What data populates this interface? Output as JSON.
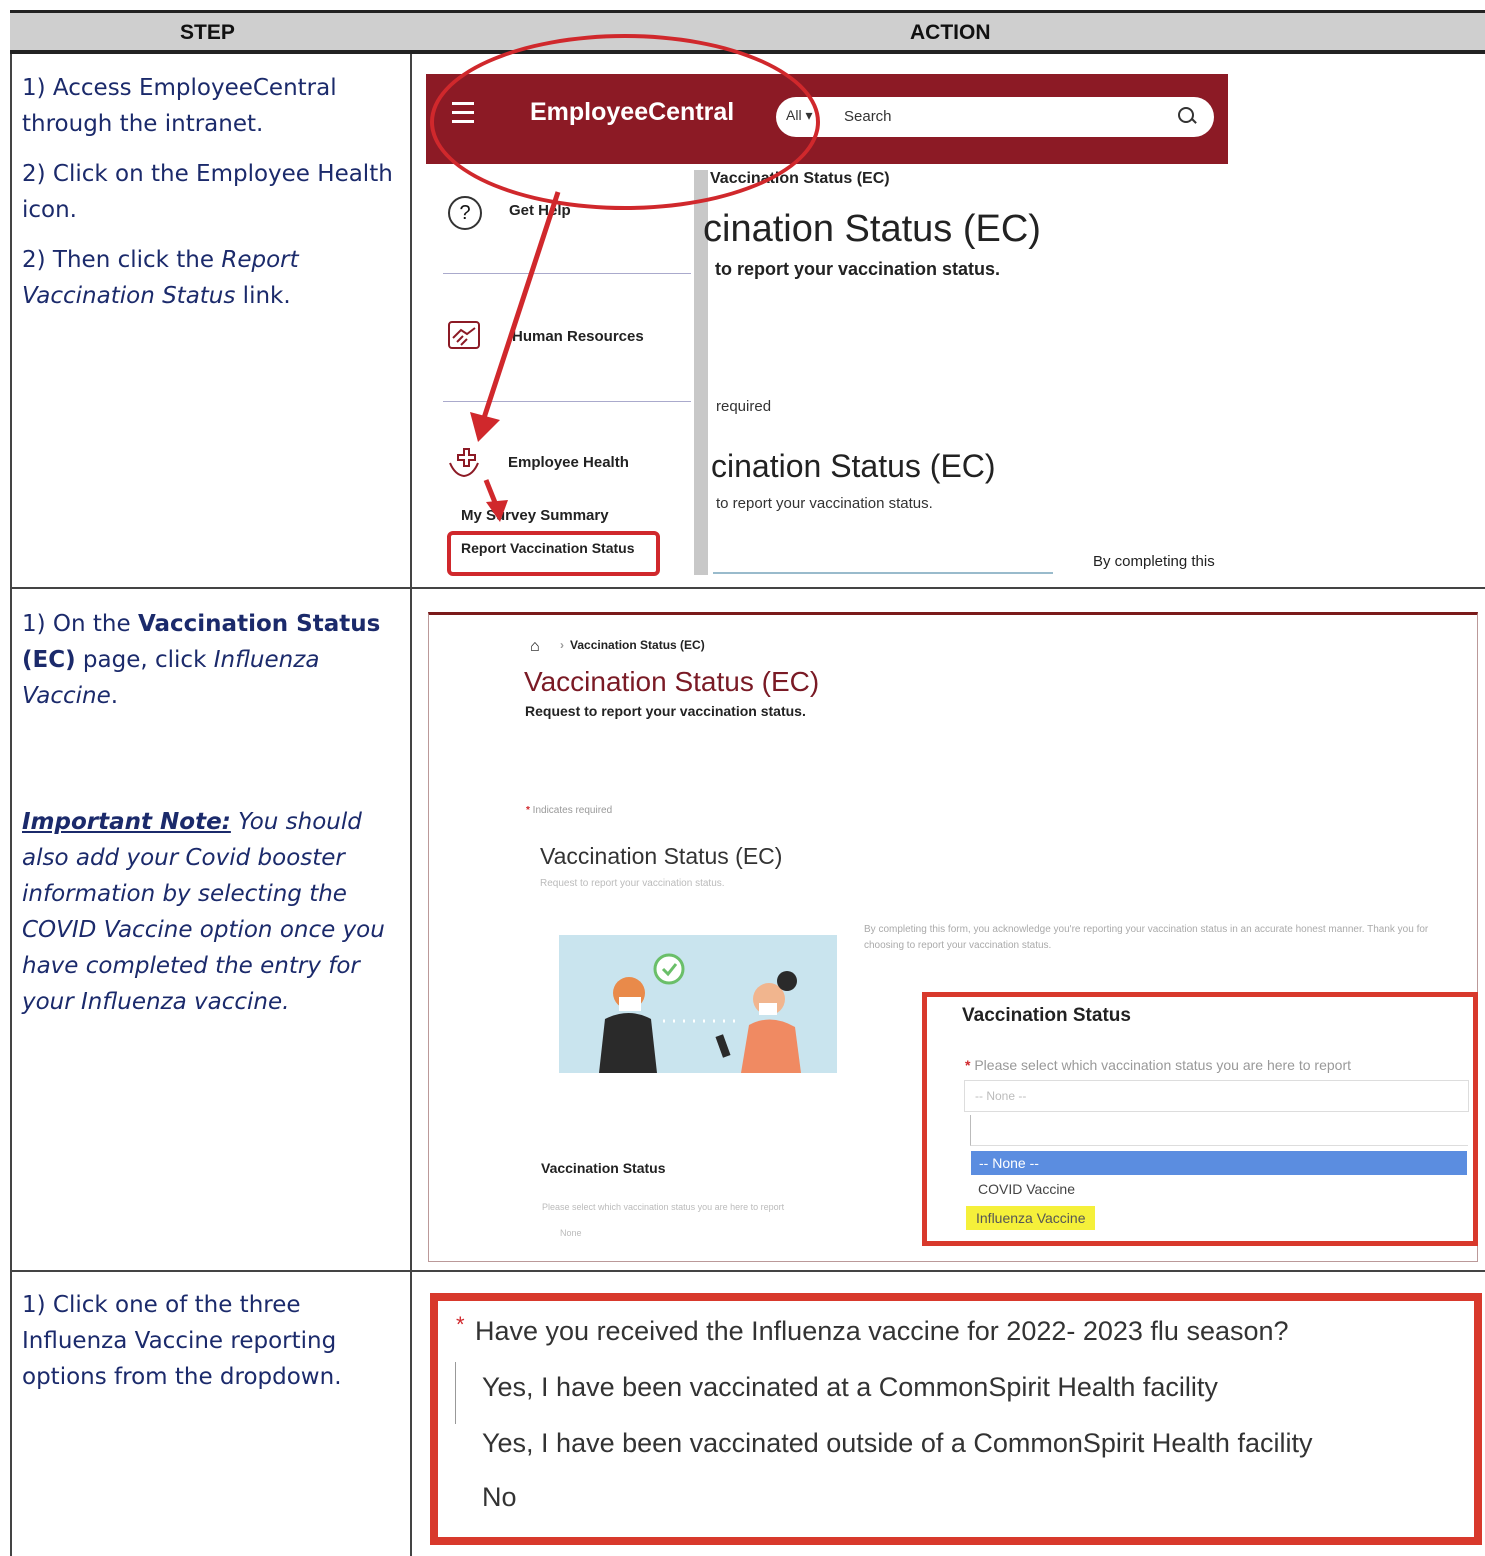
{
  "header": {
    "step": "STEP",
    "action": "ACTION"
  },
  "row1": {
    "steps": [
      "1) Access EmployeeCentral through the intranet.",
      "2) Click on the Employee Health icon."
    ],
    "step3_prefix": "2) Then click the ",
    "step3_link": "Report Vaccination Status",
    "step3_suffix": " link.",
    "screen": {
      "app_title": "EmployeeCentral",
      "search_scope": "All",
      "search_placeholder": "Search",
      "get_help": "Get Help",
      "human_resources": "Human Resources",
      "employee_health": "Employee Health",
      "my_survey_summary": "My Survey Summary",
      "report_vaccination_status": "Report Vaccination Status",
      "crumb": "Vaccination Status (EC)",
      "big_title": "cination Status (EC)",
      "subtitle": "to report your vaccination status.",
      "required": "required",
      "big_title_2": "cination Status (EC)",
      "subtitle_2": "to report your vaccination status.",
      "by_completing": "By completing this"
    }
  },
  "row2": {
    "step_prefix": "1) On the ",
    "step_bold": "Vaccination Status (EC)",
    "step_mid": " page, click ",
    "step_italic": "Influenza Vaccine",
    "step_end": ".",
    "note_label": "Important Note:",
    "note_text": " You should also add your Covid booster information by selecting the COVID Vaccine option once you have completed the entry for your Influenza vaccine.",
    "screen": {
      "crumb": "Vaccination Status (EC)",
      "title": "Vaccination Status (EC)",
      "subtitle": "Request to report your vaccination status.",
      "indicates_required": "Indicates required",
      "form_title": "Vaccination Status (EC)",
      "form_subtitle": "Request to report your vaccination status.",
      "by_completing": "By completing this form, you acknowledge you're reporting your vaccination status in an accurate honest manner. Thank you for choosing to report your vaccination status.",
      "vs_label": "Vaccination Status",
      "vs_question_small": "Please select which vaccination status you are here to report",
      "vs_none_small": "None",
      "box_title": "Vaccination Status",
      "box_question": "Please select which vaccination status you are here to report",
      "box_none": "-- None --",
      "options": [
        "-- None --",
        "COVID Vaccine",
        "Influenza Vaccine"
      ]
    }
  },
  "row3": {
    "step": "1) Click one of the three Influenza Vaccine reporting options from the dropdown.",
    "question": "Have you received the Influenza vaccine for 2022- 2023 flu season?",
    "options": [
      "Yes, I have been vaccinated at a CommonSpirit Health facility",
      "Yes, I have been vaccinated outside of a CommonSpirit Health facility",
      "No"
    ]
  },
  "colors": {
    "brand_bar": "#8c1a25",
    "highlight_red": "#d8392c",
    "selected_option": "#5b8de0",
    "flu_highlight": "#f5f03a",
    "step_text": "#1b2a6b"
  },
  "icons": [
    "hamburger-icon",
    "search-icon",
    "help-icon",
    "handshake-icon",
    "health-icon",
    "home-icon",
    "red-arrow-icon"
  ]
}
